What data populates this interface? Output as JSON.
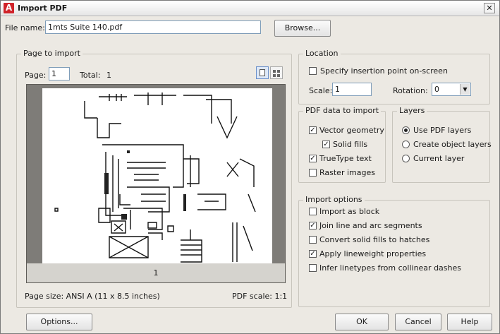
{
  "title": "Import PDF",
  "file": {
    "label": "File name:",
    "value": "1mts Suite 140.pdf",
    "browse": "Browse..."
  },
  "page_to_import": {
    "title": "Page to import",
    "page_label": "Page:",
    "page_value": "1",
    "total_label": "Total:",
    "total_value": "1",
    "preview_page_number": "1",
    "page_size": "Page size: ANSI A (11 x 8.5 inches)",
    "pdf_scale": "PDF scale: 1:1"
  },
  "location": {
    "title": "Location",
    "specify_label": "Specify insertion point on-screen",
    "specify_checked": false,
    "scale_label": "Scale:",
    "scale_value": "1",
    "rotation_label": "Rotation:",
    "rotation_value": "0"
  },
  "pdf_data": {
    "title": "PDF data to import",
    "items": [
      {
        "label": "Vector geometry",
        "checked": true
      },
      {
        "label": "Solid fills",
        "checked": true
      },
      {
        "label": "TrueType text",
        "checked": true
      },
      {
        "label": "Raster images",
        "checked": false
      }
    ]
  },
  "layers": {
    "title": "Layers",
    "options": [
      {
        "label": "Use PDF layers",
        "selected": true
      },
      {
        "label": "Create object layers",
        "selected": false
      },
      {
        "label": "Current layer",
        "selected": false
      }
    ]
  },
  "import_options": {
    "title": "Import options",
    "items": [
      {
        "label": "Import as block",
        "checked": false
      },
      {
        "label": "Join line and arc segments",
        "checked": true
      },
      {
        "label": "Convert solid fills to hatches",
        "checked": false
      },
      {
        "label": "Apply lineweight properties",
        "checked": true
      },
      {
        "label": "Infer linetypes from collinear dashes",
        "checked": false
      }
    ]
  },
  "buttons": {
    "options": "Options...",
    "ok": "OK",
    "cancel": "Cancel",
    "help": "Help"
  },
  "icons": {
    "app": "autocad-logo-icon",
    "close": "close-icon",
    "single_view": "single-page-view-icon",
    "thumbnail_view": "thumbnail-view-icon",
    "dropdown": "chevron-down-icon"
  },
  "colors": {
    "logo": "#d0232a",
    "dialog": "#ece9e3",
    "preview_bg": "#7e7c78"
  }
}
